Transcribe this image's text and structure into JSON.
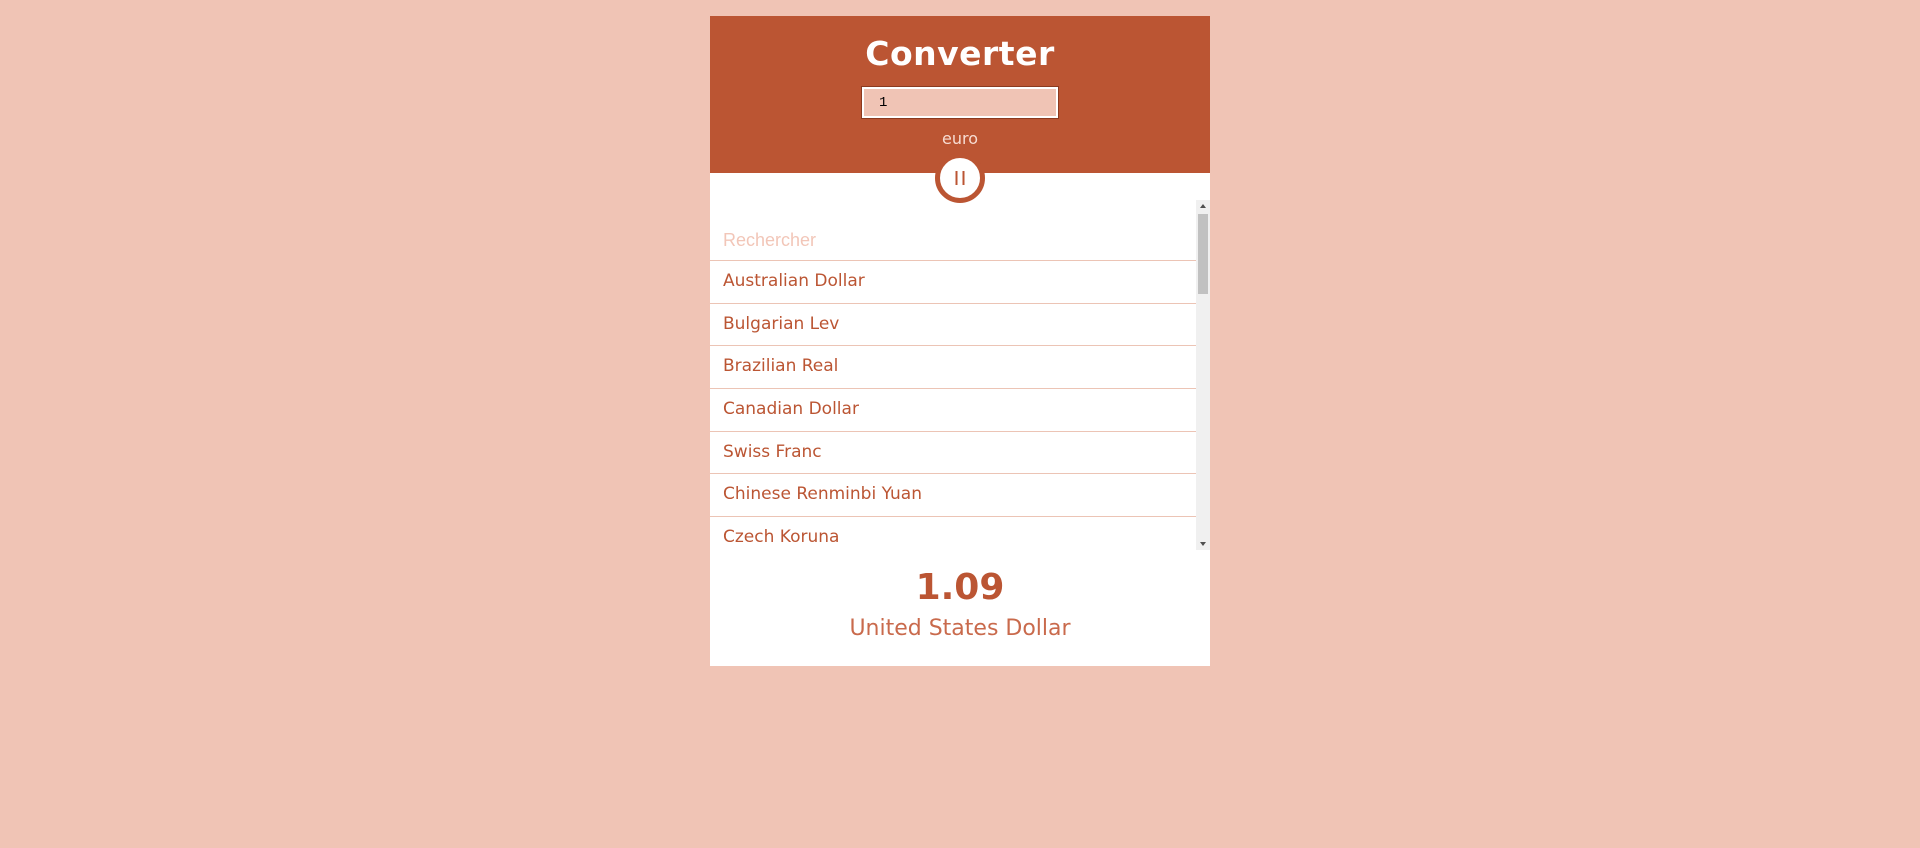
{
  "app": {
    "title": "Converter"
  },
  "converter": {
    "amount_value": "1",
    "base_currency": "euro",
    "search_placeholder": "Rechercher",
    "currencies": [
      "Australian Dollar",
      "Bulgarian Lev",
      "Brazilian Real",
      "Canadian Dollar",
      "Swiss Franc",
      "Chinese Renminbi Yuan",
      "Czech Koruna"
    ],
    "result_value": "1.09",
    "result_currency": "United States Dollar"
  },
  "icons": {
    "swap": "swap-icon",
    "scroll_up": "scroll-up-arrow-icon",
    "scroll_down": "scroll-down-arrow-icon"
  },
  "colors": {
    "background": "#f0c4b5",
    "accent": "#bb5533",
    "card": "#ffffff"
  }
}
